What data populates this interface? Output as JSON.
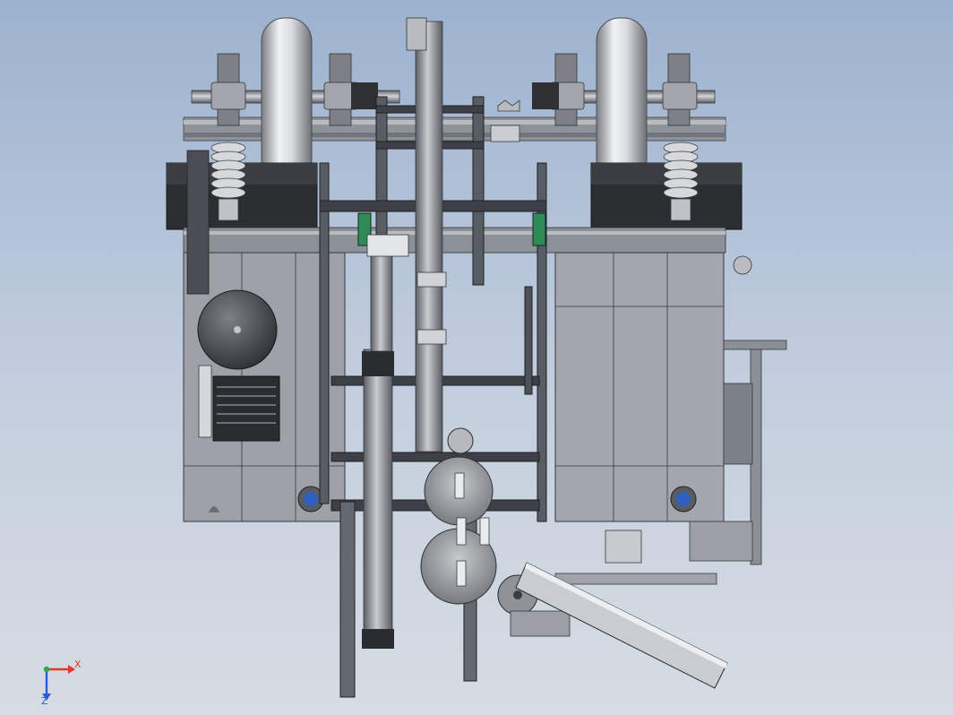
{
  "viewport": {
    "background_top": "#9db2cf",
    "background_bottom": "#d7dce3"
  },
  "triad": {
    "x_label": "X",
    "z_label": "Z",
    "x_color": "#e03a2b",
    "z_color": "#2a5bd7",
    "y_color": "#2aa84a"
  },
  "colors": {
    "frame": "#4d5259",
    "panel": "#9a9ea5",
    "panel_dark": "#5b5f66",
    "accent_blue": "#2f5fc0",
    "accent_green": "#2e8b57"
  }
}
